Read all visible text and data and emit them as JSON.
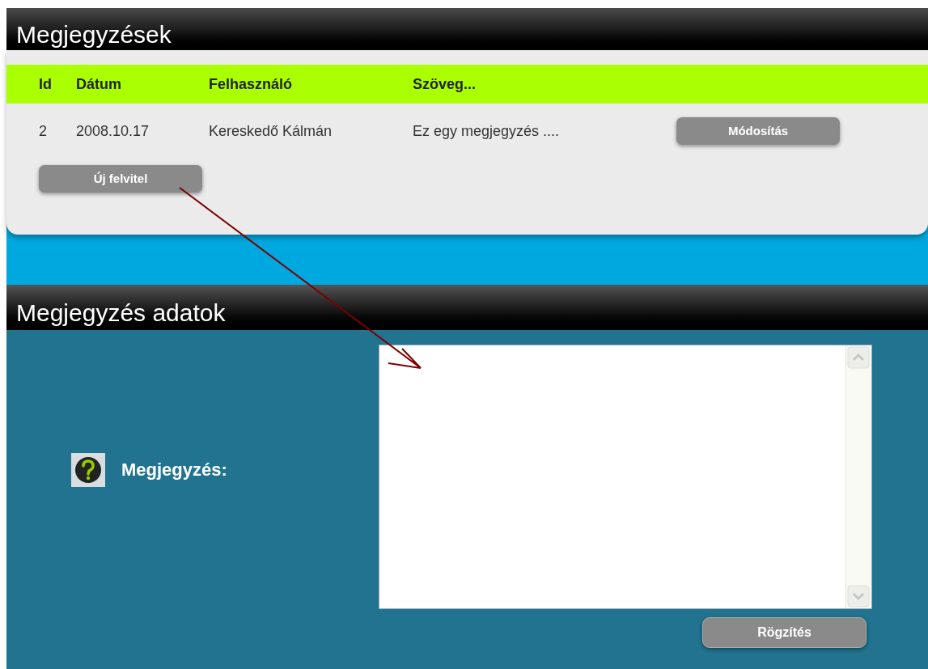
{
  "notes_panel": {
    "title": "Megjegyzések",
    "table": {
      "columns": [
        "Id",
        "Dátum",
        "Felhasználó",
        "Szöveg..."
      ],
      "rows": [
        {
          "cells": [
            "2",
            "2008.10.17",
            "Kereskedő Kálmán",
            "Ez egy megjegyzés ...."
          ],
          "button": "Módosítás"
        }
      ]
    },
    "new_button": "Új felvitel"
  },
  "details_panel": {
    "title": "Megjegyzés adatok",
    "field_label": "Megjegyzés:",
    "save_button": "Rögzítés"
  }
}
